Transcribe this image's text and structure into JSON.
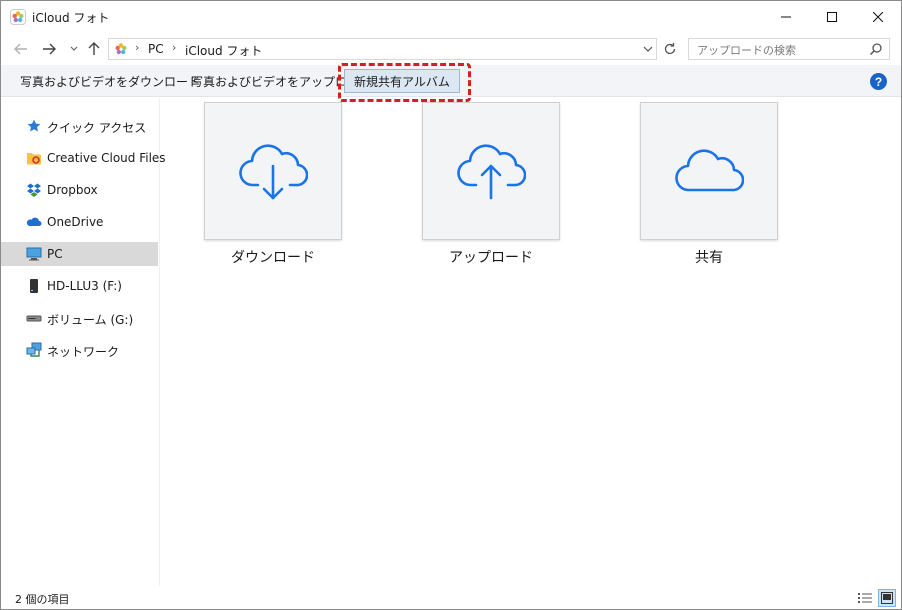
{
  "window": {
    "title": "iCloud フォト"
  },
  "address": {
    "segments": [
      "PC",
      "iCloud フォト"
    ],
    "search_placeholder": "アップロードの検索"
  },
  "commands": {
    "download": "写真およびビデオをダウンロード",
    "upload": "写真およびビデオをアップロード",
    "new_shared_album": "新規共有アルバム",
    "help": "?"
  },
  "sidebar": {
    "items": [
      {
        "label": "クイック アクセス",
        "icon": "star-icon"
      },
      {
        "label": "Creative Cloud Files",
        "icon": "creative-cloud-folder-icon"
      },
      {
        "label": "Dropbox",
        "icon": "dropbox-icon"
      },
      {
        "label": "OneDrive",
        "icon": "onedrive-icon"
      },
      {
        "label": "PC",
        "icon": "pc-icon",
        "selected": true
      },
      {
        "label": "HD-LLU3 (F:)",
        "icon": "external-drive-icon"
      },
      {
        "label": "ボリューム (G:)",
        "icon": "drive-icon"
      },
      {
        "label": "ネットワーク",
        "icon": "network-icon"
      }
    ]
  },
  "tiles": [
    {
      "label": "ダウンロード",
      "icon": "cloud-download-icon"
    },
    {
      "label": "アップロード",
      "icon": "cloud-upload-icon"
    },
    {
      "label": "共有",
      "icon": "cloud-icon"
    }
  ],
  "status": {
    "text": "2 個の項目"
  },
  "colors": {
    "accent_blue": "#1a73e8",
    "highlight_red": "#d61f1f",
    "selected_bg": "#d9d9d9"
  }
}
